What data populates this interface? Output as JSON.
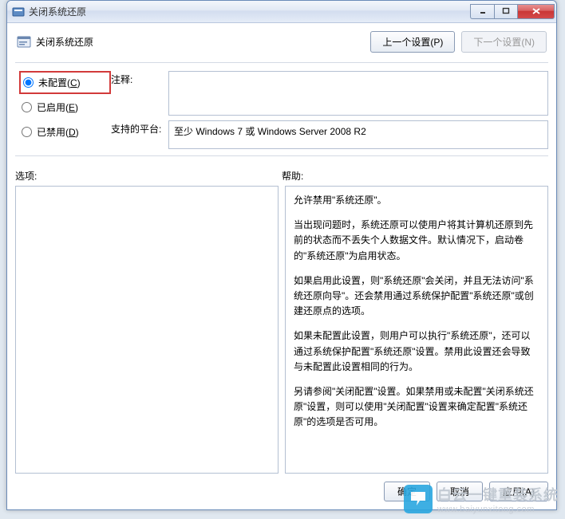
{
  "window": {
    "title": "关闭系统还原"
  },
  "header": {
    "title": "关闭系统还原",
    "prev_button": "上一个设置(P)",
    "next_button": "下一个设置(N)"
  },
  "radios": {
    "not_configured": {
      "label": "未配置(",
      "hotkey": "C",
      "suffix": ")",
      "checked": true
    },
    "enabled": {
      "label": "已启用(",
      "hotkey": "E",
      "suffix": ")",
      "checked": false
    },
    "disabled": {
      "label": "已禁用(",
      "hotkey": "D",
      "suffix": ")",
      "checked": false
    }
  },
  "fields": {
    "comment_label": "注释:",
    "comment_value": "",
    "platform_label": "支持的平台:",
    "platform_value": "至少 Windows 7 或 Windows Server 2008 R2"
  },
  "panels": {
    "options_label": "选项:",
    "help_label": "帮助:",
    "help_paragraphs": [
      "允许禁用\"系统还原\"。",
      "当出现问题时，系统还原可以使用户将其计算机还原到先前的状态而不丢失个人数据文件。默认情况下，启动卷的\"系统还原\"为启用状态。",
      "如果启用此设置，则\"系统还原\"会关闭，并且无法访问\"系统还原向导\"。还会禁用通过系统保护配置\"系统还原\"或创建还原点的选项。",
      "如果未配置此设置，则用户可以执行\"系统还原\"，还可以通过系统保护配置\"系统还原\"设置。禁用此设置还会导致与未配置此设置相同的行为。",
      "另请参阅\"关闭配置\"设置。如果禁用或未配置\"关闭系统还原\"设置，则可以使用\"关闭配置\"设置来确定配置\"系统还原\"的选项是否可用。"
    ]
  },
  "footer": {
    "ok": "确定",
    "cancel": "取消",
    "apply": "应用(A)"
  },
  "watermark": {
    "brand": "白云一键重装系统",
    "url": "www.baiyunxitong.com"
  }
}
